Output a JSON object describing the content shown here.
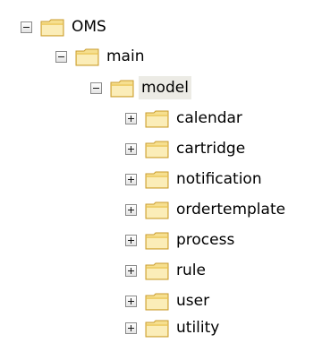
{
  "tree": {
    "root": {
      "label": "OMS",
      "state": "expanded"
    },
    "main": {
      "label": "main",
      "state": "expanded"
    },
    "model": {
      "label": "model",
      "state": "expanded",
      "selected": true
    },
    "children": [
      {
        "label": "calendar",
        "state": "collapsed"
      },
      {
        "label": "cartridge",
        "state": "collapsed"
      },
      {
        "label": "notification",
        "state": "collapsed"
      },
      {
        "label": "ordertemplate",
        "state": "collapsed"
      },
      {
        "label": "process",
        "state": "collapsed"
      },
      {
        "label": "rule",
        "state": "collapsed"
      },
      {
        "label": "user",
        "state": "collapsed"
      },
      {
        "label": "utility",
        "state": "collapsed"
      }
    ]
  },
  "colors": {
    "folder_fill": "#f6df8f",
    "folder_border": "#c89b2c",
    "selection_bg": "#ecebe5",
    "expander_border": "#8a8a8a"
  },
  "icons": {
    "folder": "folder-icon",
    "expanded": "minus-expander-icon",
    "collapsed": "plus-expander-icon"
  }
}
